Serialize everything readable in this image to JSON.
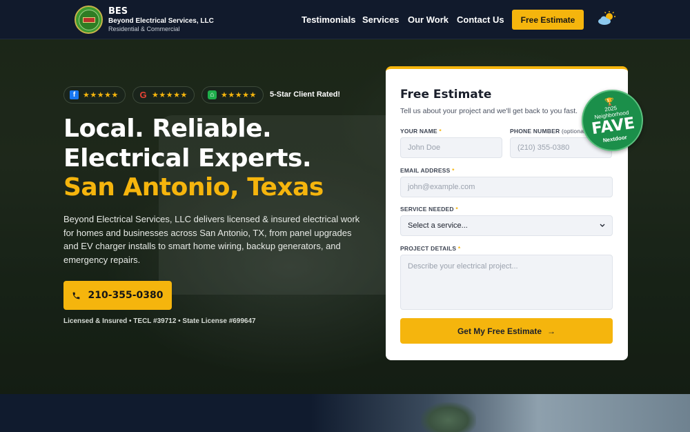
{
  "brand": {
    "short": "BES",
    "full": "Beyond Electrical Services, LLC",
    "tagline": "Residential & Commercial"
  },
  "nav": {
    "items": [
      "Testimonials",
      "Services",
      "Our Work",
      "Contact Us"
    ],
    "cta": "Free Estimate",
    "theme_icon": "sun-cloud-icon"
  },
  "hero": {
    "reviews": [
      {
        "platform_icon": "facebook-icon",
        "stars": "★★★★★"
      },
      {
        "platform_icon": "google-icon",
        "stars": "★★★★★"
      },
      {
        "platform_icon": "nextdoor-icon",
        "stars": "★★★★★"
      }
    ],
    "rated_label": "5-Star Client Rated!",
    "headline_line1": "Local. Reliable.",
    "headline_line2": "Electrical Experts.",
    "headline_line3": "San Antonio, Texas",
    "description": "Beyond Electrical Services, LLC delivers licensed & insured electrical work for homes and businesses across San Antonio, TX, from panel upgrades and EV charger installs to smart home wiring, backup generators, and emergency repairs.",
    "phone": "210-355-0380",
    "license_text": "Licensed & Insured • TECL #39712 • State License #699647"
  },
  "form": {
    "title": "Free Estimate",
    "subtitle": "Tell us about your project and we'll get back to you fast.",
    "name_label": "YOUR NAME",
    "name_placeholder": "John Doe",
    "phone_label": "PHONE NUMBER",
    "phone_optional": "(optional)",
    "phone_placeholder": "(210) 355-0380",
    "email_label": "EMAIL ADDRESS",
    "email_placeholder": "john@example.com",
    "service_label": "SERVICE NEEDED",
    "service_selected": "Select a service...",
    "details_label": "PROJECT DETAILS",
    "details_placeholder": "Describe your electrical project...",
    "required_mark": "*",
    "submit_label": "Get My Free Estimate",
    "submit_arrow": "→"
  },
  "badge": {
    "year": "2025",
    "line1": "Neighborhood",
    "line2": "FAVE",
    "brand": "Nextdoor"
  },
  "colors": {
    "accent": "#f5b50d",
    "header_bg": "#111a2c",
    "badge_green": "#1b8f4a"
  }
}
